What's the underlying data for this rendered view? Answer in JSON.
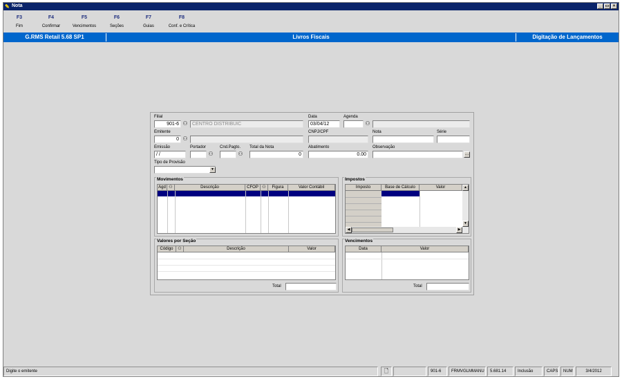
{
  "window": {
    "title": "Nota",
    "controls": [
      "_",
      "▭",
      "×"
    ]
  },
  "toolbar": {
    "keys": [
      {
        "key": "F3",
        "label": "Fim"
      },
      {
        "key": "F4",
        "label": "Confirmar"
      },
      {
        "key": "F5",
        "label": "Vencimentos"
      },
      {
        "key": "F6",
        "label": "Seções"
      },
      {
        "key": "F7",
        "label": "Guias"
      },
      {
        "key": "F8",
        "label": "Conf. e Crítica"
      }
    ]
  },
  "header": {
    "app": "G.RMS Retail 5.68 SP1",
    "module": "Livros Fiscais",
    "screen": "Digitação de Lançamentos"
  },
  "form": {
    "filial_label": "Filial",
    "filial_code": "901-6",
    "filial_name": "CENTRO DISTRIBUIC",
    "data_label": "Data",
    "data_value": "03/04/12",
    "agenda_label": "Agenda",
    "agenda_value": "",
    "emitente_label": "Emitente",
    "emitente_value": "0",
    "cnpj_label": "CNPJ/CPF",
    "nota_label": "Nota",
    "serie_label": "Série",
    "emissao_label": "Emissão",
    "emissao_value": " / /",
    "portador_label": "Portador",
    "cndpagto_label": "Cnd.Pagto.",
    "total_nota_label": "Total da Nota",
    "total_nota_value": "0",
    "abatimento_label": "Abatimento",
    "abatimento_value": "0.00",
    "observacao_label": "Observação",
    "tipo_provisao_label": "Tipo de Provisão"
  },
  "movimentos": {
    "title": "Movimentos",
    "columns": [
      "Agd",
      "Descrição",
      "CFOP",
      "Figura",
      "Valor Contábil"
    ]
  },
  "impostos": {
    "title": "Impostos",
    "columns": [
      "Imposto",
      "Base de Cálculo",
      "Valor"
    ]
  },
  "valores_secao": {
    "title": "Valores por Seção",
    "columns": [
      "Código",
      "Descrição",
      "Valor"
    ],
    "total_label": "Total"
  },
  "vencimentos": {
    "title": "Vencimentos",
    "columns": [
      "Data",
      "Valor"
    ],
    "total_label": "Total"
  },
  "status": {
    "message": "Digite o emitente",
    "filial": "901-6",
    "form": "FRMVGLMMANU",
    "version": "5.681.14",
    "mode": "Inclusão",
    "caps": "CAPS",
    "num": "NUM",
    "date": "3/4/2012"
  },
  "colors": {
    "title_bar": "#0a246a",
    "header_bar": "#0066cc",
    "selection": "#000080"
  },
  "icons": {
    "search": "binoculars-icon",
    "app": "app-icon",
    "note": "document-icon"
  }
}
